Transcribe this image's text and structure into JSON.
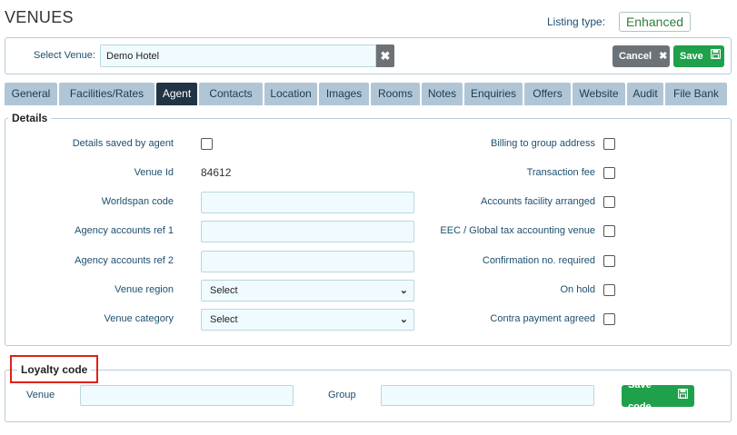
{
  "header": {
    "title": "VENUES",
    "listing_type_label": "Listing type:",
    "listing_type_value": "Enhanced"
  },
  "venue_bar": {
    "label": "Select Venue:",
    "value": "Demo Hotel",
    "clear_icon": "close-icon",
    "cancel_label": "Cancel",
    "save_label": "Save"
  },
  "tabs": [
    {
      "label": "General",
      "active": false
    },
    {
      "label": "Facilities/Rates",
      "active": false
    },
    {
      "label": "Agent",
      "active": true
    },
    {
      "label": "Contacts",
      "active": false
    },
    {
      "label": "Location",
      "active": false
    },
    {
      "label": "Images",
      "active": false
    },
    {
      "label": "Rooms",
      "active": false
    },
    {
      "label": "Notes",
      "active": false
    },
    {
      "label": "Enquiries",
      "active": false
    },
    {
      "label": "Offers",
      "active": false
    },
    {
      "label": "Website",
      "active": false
    },
    {
      "label": "Audit",
      "active": false
    },
    {
      "label": "File Bank",
      "active": false
    }
  ],
  "details": {
    "legend": "Details",
    "left": {
      "details_saved_by_agent": "Details saved by agent",
      "venue_id_label": "Venue Id",
      "venue_id_value": "84612",
      "worldspan_code": "Worldspan code",
      "agency_ref_1": "Agency accounts ref 1",
      "agency_ref_2": "Agency accounts ref 2",
      "venue_region": "Venue region",
      "venue_region_value": "Select",
      "venue_category": "Venue category",
      "venue_category_value": "Select"
    },
    "right": {
      "billing_to_group": "Billing to group address",
      "transaction_fee": "Transaction fee",
      "accounts_facility": "Accounts facility arranged",
      "eec_global_tax": "EEC / Global tax accounting venue",
      "confirmation_required": "Confirmation no. required",
      "on_hold": "On hold",
      "contra_payment": "Contra payment agreed"
    }
  },
  "loyalty": {
    "legend": "Loyalty code",
    "venue_label": "Venue",
    "group_label": "Group",
    "save_code_label": "Save code"
  },
  "colors": {
    "tab_bg": "#b0c6d6",
    "tab_active": "#213444",
    "save_green": "#1fa04a",
    "cancel_grey": "#6c7378",
    "highlight_red": "#e0201a"
  }
}
